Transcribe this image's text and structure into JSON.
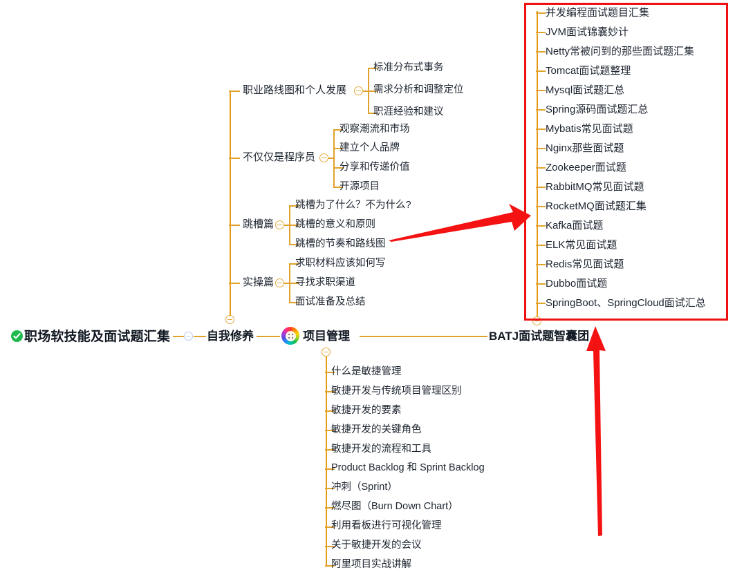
{
  "meta": {
    "kind": "mindmap",
    "accent_line_color": "#e0a22b",
    "highlight_color": "#ef1111",
    "root_icon_color": "#1fb950"
  },
  "root": {
    "label": "职场软技能及面试题汇集",
    "icon": "check-circle-icon"
  },
  "branches": [
    {
      "id": "self-cultivation",
      "label": "自我修养",
      "toggle": "collapse-toggle",
      "children": [
        {
          "label": "职业路线图和个人发展",
          "toggle": "collapse-toggle",
          "children": [
            "标准分布式事务",
            "需求分析和调整定位",
            "职涯经验和建议"
          ]
        },
        {
          "label": "不仅仅是程序员",
          "toggle": "collapse-toggle",
          "children": [
            "观察潮流和市场",
            "建立个人品牌",
            "分享和传递价值",
            "开源项目"
          ]
        },
        {
          "label": "跳槽篇",
          "toggle": "collapse-toggle",
          "children": [
            "跳槽为了什么？不为什么?",
            "跳槽的意义和原则",
            "跳槽的节奏和路线图"
          ]
        },
        {
          "label": "实操篇",
          "toggle": "collapse-toggle",
          "children": [
            "求职材料应该如何写",
            "寻找求职渠道",
            "面试准备及总结"
          ]
        }
      ]
    },
    {
      "id": "project-management",
      "label": "项目管理",
      "icon": "color-wheel-icon",
      "toggle": "collapse-toggle",
      "children": [
        "什么是敏捷管理",
        "敏捷开发与传统项目管理区别",
        "敏捷开发的要素",
        "敏捷开发的关键角色",
        "敏捷开发的流程和工具",
        "Product Backlog 和 Sprint Backlog",
        "冲刺（Sprint）",
        "燃尽图（Burn Down Chart）",
        "利用看板进行可视化管理",
        "关于敏捷开发的会议",
        "阿里项目实战讲解"
      ]
    },
    {
      "id": "batj",
      "label": "BATJ面试题智囊团",
      "toggle": "collapse-toggle",
      "children": [
        "并发编程面试题目汇集",
        "JVM面试锦囊妙计",
        "Netty常被问到的那些面试题汇集",
        "Tomcat面试题整理",
        "Mysql面试题汇总",
        "Spring源码面试题汇总",
        "Mybatis常见面试题",
        "Nginx那些面试题",
        "Zookeeper面试题",
        "RabbitMQ常见面试题",
        "RocketMQ面试题汇集",
        "Kafka面试题",
        "ELK常见面试题",
        "Redis常见面试题",
        "Dubbo面试题",
        "SpringBoot、SpringCloud面试汇总"
      ]
    }
  ],
  "annotations": [
    {
      "id": "arrow-diagonal",
      "type": "red-arrow",
      "direction": "up-right"
    },
    {
      "id": "arrow-vertical",
      "type": "red-arrow",
      "direction": "up"
    },
    {
      "id": "highlight-box",
      "type": "red-rectangle",
      "target": "batj"
    }
  ]
}
